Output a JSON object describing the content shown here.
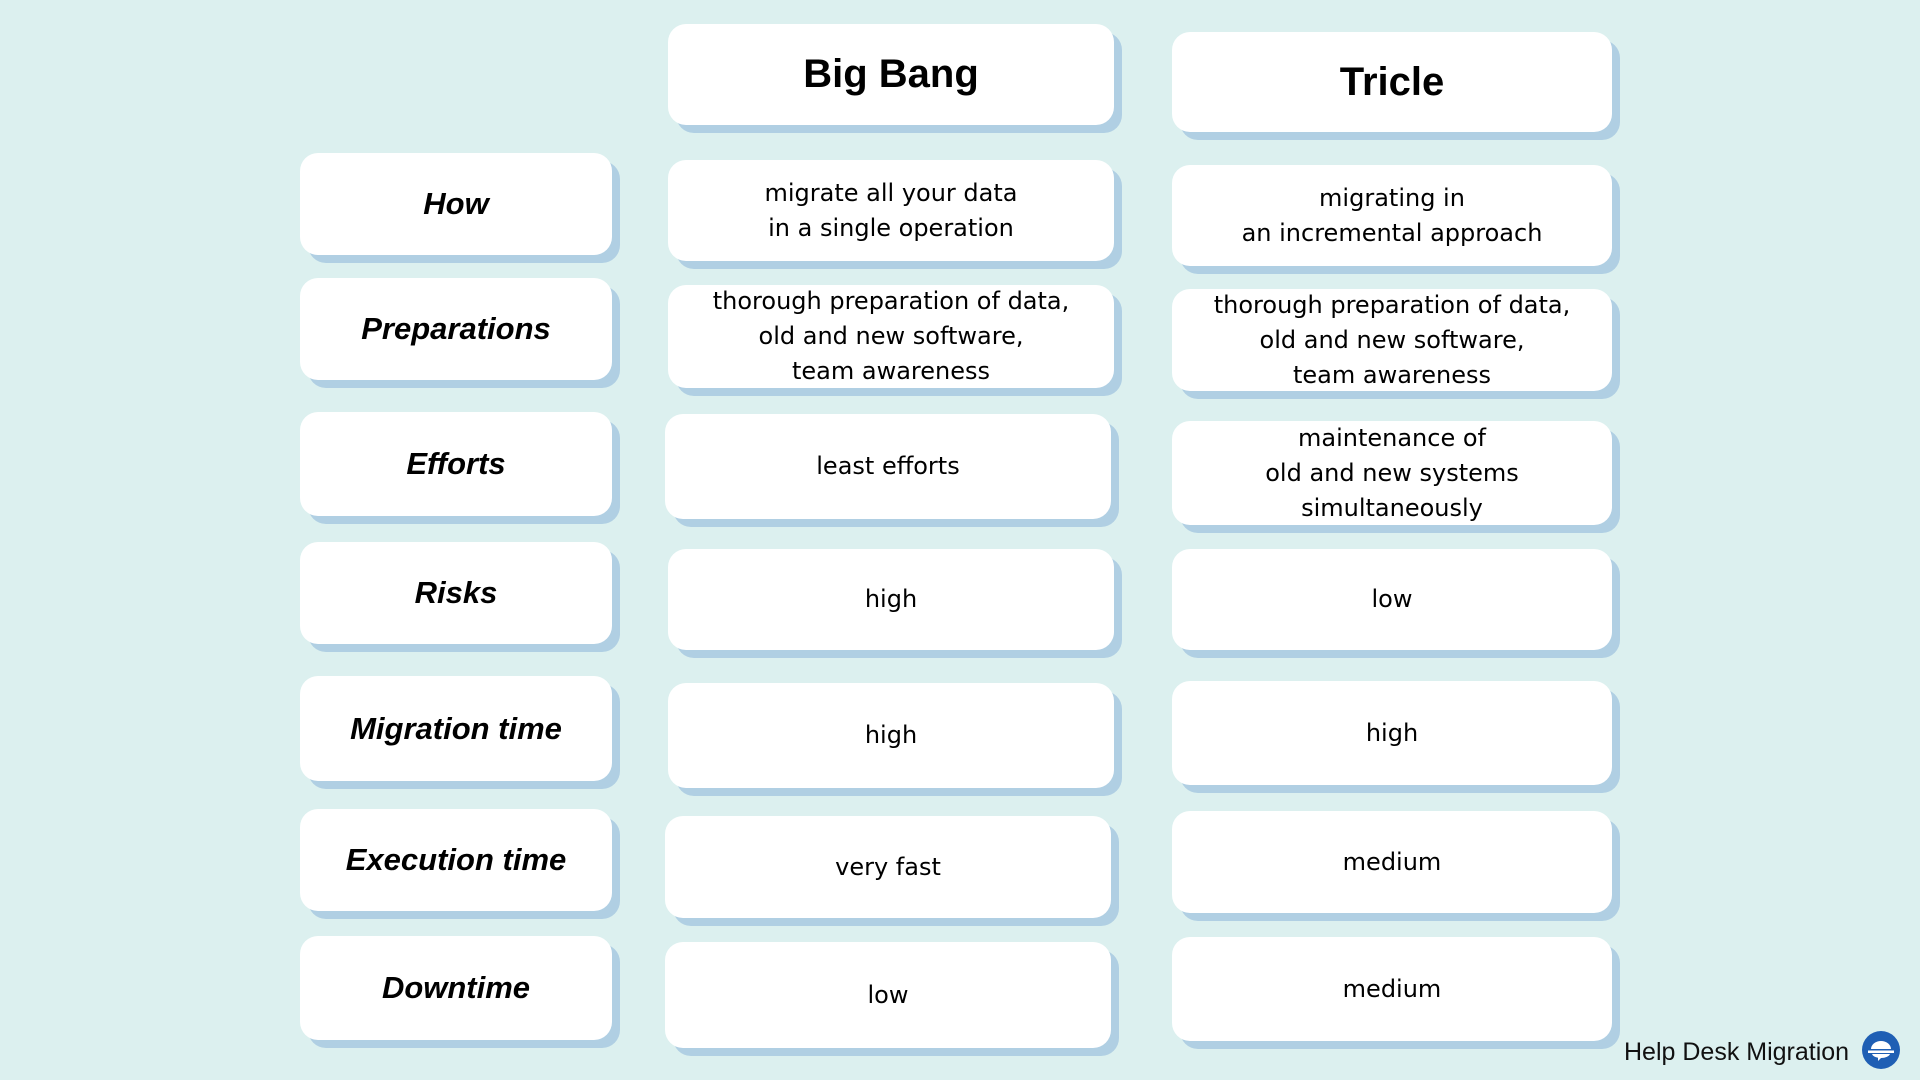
{
  "columns": {
    "big_bang": "Big Bang",
    "tricle": "Tricle"
  },
  "rows": [
    {
      "label": "How",
      "big_bang": "migrate all your data\nin a single operation",
      "tricle": "migrating in\nan incremental approach"
    },
    {
      "label": "Preparations",
      "big_bang": "thorough preparation of data,\nold and new software,\nteam awareness",
      "tricle": "thorough preparation of data,\nold and new software,\nteam awareness"
    },
    {
      "label": "Efforts",
      "big_bang": "least efforts",
      "tricle": "maintenance of\nold and new systems simultaneously"
    },
    {
      "label": "Risks",
      "big_bang": "high",
      "tricle": "low"
    },
    {
      "label": "Migration time",
      "big_bang": "high",
      "tricle": "high"
    },
    {
      "label": "Execution time",
      "big_bang": "very fast",
      "tricle": "medium"
    },
    {
      "label": "Downtime",
      "big_bang": "low",
      "tricle": "medium"
    }
  ],
  "footer": {
    "brand": "Help Desk Migration",
    "logo_icon": "planet-chat-icon",
    "logo_color": "#1f5fb4"
  },
  "colors": {
    "background": "#dcf0ef",
    "card": "#ffffff",
    "card_shadow": "#b0cfe3"
  }
}
